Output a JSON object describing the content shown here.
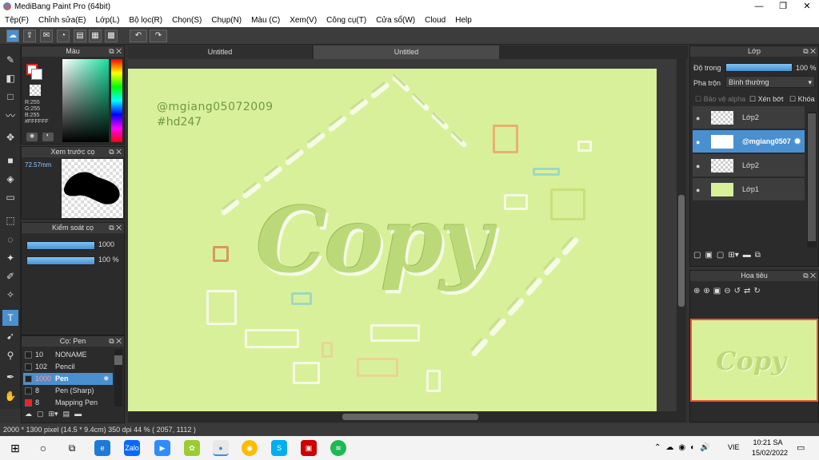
{
  "window": {
    "title": "MediBang Paint Pro (64bit)",
    "min": "—",
    "max": "❐",
    "close": "✕"
  },
  "menu": [
    "Tệp(F)",
    "Chỉnh sửa(E)",
    "Lớp(L)",
    "Bộ lọc(R)",
    "Chọn(S)",
    "Chụp(N)",
    "Màu (C)",
    "Xem(V)",
    "Công cụ(T)",
    "Cửa sổ(W)",
    "Cloud",
    "Help"
  ],
  "tabs": [
    "Untitled",
    "Untitled"
  ],
  "color_panel": {
    "title": "Màu",
    "r": "R:255",
    "g": "G:255",
    "b": "B:255",
    "hex": "#FFFFFF"
  },
  "preview_panel": {
    "title": "Xem trước cọ",
    "size": "72.57mm"
  },
  "brush_control": {
    "title": "Kiểm soát cọ",
    "size": "1000",
    "opacity": "100 %",
    "size_fraction": 1.0,
    "opacity_fraction": 1.0
  },
  "brush_panel": {
    "title": "Cọ: Pen",
    "items": [
      {
        "size": "10",
        "name": "NONAME"
      },
      {
        "size": "102",
        "name": "Pencil"
      },
      {
        "size": "1000",
        "name": "Pen"
      },
      {
        "size": "8",
        "name": "Pen (Sharp)"
      },
      {
        "size": "8",
        "name": "Mapping Pen"
      }
    ]
  },
  "layer_panel": {
    "title": "Lớp",
    "opacity_label": "Độ trong",
    "opacity_value": "100 %",
    "blend_label": "Pha trộn",
    "blend_value": "Bình thường",
    "protect_alpha": "Bảo vệ alpha",
    "clipping": "Xén bớt",
    "lock": "Khóa",
    "layers": [
      "Lớp2",
      "@mgiang0507",
      "Lớp2",
      "Lớp1"
    ]
  },
  "navigator_panel": {
    "title": "Hoa tiêu"
  },
  "canvas": {
    "watermark_line1": "@mgiang05072009",
    "watermark_line2": "#hd247",
    "art_text": "Copy"
  },
  "status": "2000 * 1300 pixel   (14.5 * 9.4cm)   350 dpi   44 %   ( 2057, 1112 )",
  "taskbar": {
    "lang": "VIE",
    "time": "10:21 SA",
    "date": "15/02/2022",
    "zalo": "Zalo"
  },
  "colors": {
    "accent": "#4a90d0",
    "canvas": "#d9f09a",
    "panel": "#2b2b2b"
  }
}
